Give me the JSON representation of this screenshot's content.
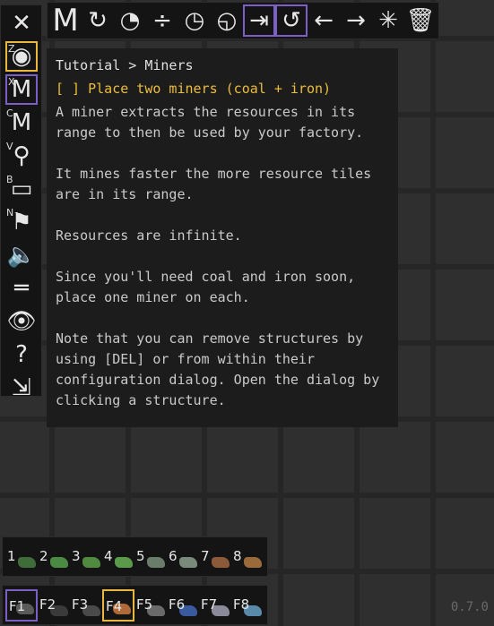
{
  "toolbar": {
    "items": [
      {
        "name": "miner-tool",
        "glyph": "M",
        "selected": false
      },
      {
        "name": "undo-rotate",
        "glyph": "↻",
        "selected": false
      },
      {
        "name": "rotate-cw",
        "glyph": "◔",
        "selected": false
      },
      {
        "name": "divide",
        "glyph": "÷",
        "selected": false
      },
      {
        "name": "clock",
        "glyph": "◷",
        "selected": false
      },
      {
        "name": "fast-clock",
        "glyph": "◵",
        "selected": false
      },
      {
        "name": "insert",
        "glyph": "⇥",
        "selected": true
      },
      {
        "name": "rotate-selected",
        "glyph": "↺",
        "selected": true
      },
      {
        "name": "arrow-left",
        "glyph": "←",
        "selected": false
      },
      {
        "name": "arrow-right",
        "glyph": "→",
        "selected": false
      },
      {
        "name": "burst",
        "glyph": "✳",
        "selected": false
      },
      {
        "name": "trash",
        "glyph": "🗑",
        "selected": false
      }
    ]
  },
  "sidebar": {
    "items": [
      {
        "key": "",
        "glyph": "✕",
        "state": ""
      },
      {
        "key": "Z",
        "glyph": "◉",
        "state": "yellow"
      },
      {
        "key": "X",
        "glyph": "M",
        "state": "purple"
      },
      {
        "key": "C",
        "glyph": "M",
        "state": ""
      },
      {
        "key": "V",
        "glyph": "⚲",
        "state": ""
      },
      {
        "key": "B",
        "glyph": "▭",
        "state": ""
      },
      {
        "key": "N",
        "glyph": "⚑",
        "state": ""
      },
      {
        "key": "",
        "glyph": "🔈",
        "state": ""
      },
      {
        "key": "",
        "glyph": "═",
        "state": ""
      },
      {
        "key": "",
        "glyph": "👁",
        "state": ""
      },
      {
        "key": "",
        "glyph": "?",
        "state": ""
      },
      {
        "key": "",
        "glyph": "⇲",
        "state": ""
      }
    ]
  },
  "tutorial": {
    "breadcrumb": "Tutorial > Miners",
    "task": "[ ] Place two miners (coal + iron)",
    "paragraphs": [
      "A miner extracts the resources in its range to then be used by your factory.",
      "It mines faster the more resource tiles are in its range.",
      "Resources are infinite.",
      "Since you'll need coal and iron soon, place one miner on each.",
      "Note that you can remove structures by using [DEL] or from within their configuration dialog. Open the dialog by clicking a structure."
    ]
  },
  "hotbar_numbers": {
    "slots": [
      {
        "label": "1",
        "color": "#3f6d3a"
      },
      {
        "label": "2",
        "color": "#4a8a43"
      },
      {
        "label": "3",
        "color": "#4f8a40"
      },
      {
        "label": "4",
        "color": "#5a9a4a"
      },
      {
        "label": "5",
        "color": "#6a7d6a"
      },
      {
        "label": "6",
        "color": "#7a8a7a"
      },
      {
        "label": "7",
        "color": "#8a5a3a"
      },
      {
        "label": "8",
        "color": "#9a6a3a"
      }
    ]
  },
  "hotbar_f": {
    "slots": [
      {
        "label": "F1",
        "color": "#5a5a5a",
        "state": "purple"
      },
      {
        "label": "F2",
        "color": "#3a3a3a",
        "state": ""
      },
      {
        "label": "F3",
        "color": "#4a4a4a",
        "state": ""
      },
      {
        "label": "F4",
        "color": "#b06a3a",
        "state": "yellow"
      },
      {
        "label": "F5",
        "color": "#6a6a6a",
        "state": ""
      },
      {
        "label": "F6",
        "color": "#3a5aa0",
        "state": ""
      },
      {
        "label": "F7",
        "color": "#8a8a9a",
        "state": ""
      },
      {
        "label": "F8",
        "color": "#5a8aaa",
        "state": ""
      }
    ]
  },
  "version": "0.7.0"
}
